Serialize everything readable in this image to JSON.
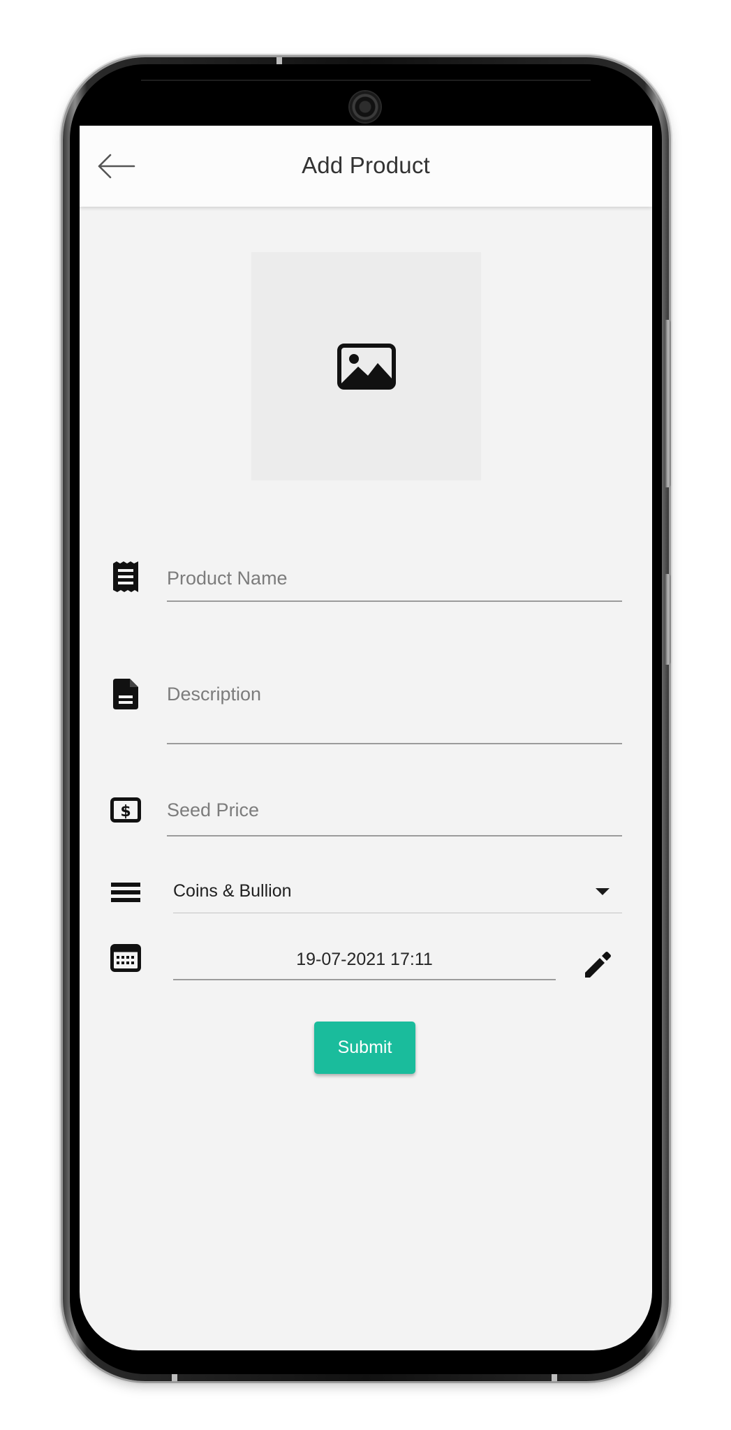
{
  "app_bar": {
    "title": "Add Product",
    "back_icon": "arrow-left-icon"
  },
  "image_picker": {
    "icon": "image-icon"
  },
  "form": {
    "product_name": {
      "icon": "receipt-icon",
      "placeholder": "Product Name",
      "value": ""
    },
    "description": {
      "icon": "description-icon",
      "placeholder": "Description",
      "value": ""
    },
    "seed_price": {
      "icon": "money-icon",
      "placeholder": "Seed Price",
      "value": ""
    },
    "category": {
      "icon": "list-icon",
      "selected": "Coins & Bullion"
    },
    "date": {
      "icon": "calendar-icon",
      "value": "19-07-2021 17:11",
      "edit_icon": "pencil-icon"
    }
  },
  "submit": {
    "label": "Submit",
    "color": "#1abc9c"
  }
}
